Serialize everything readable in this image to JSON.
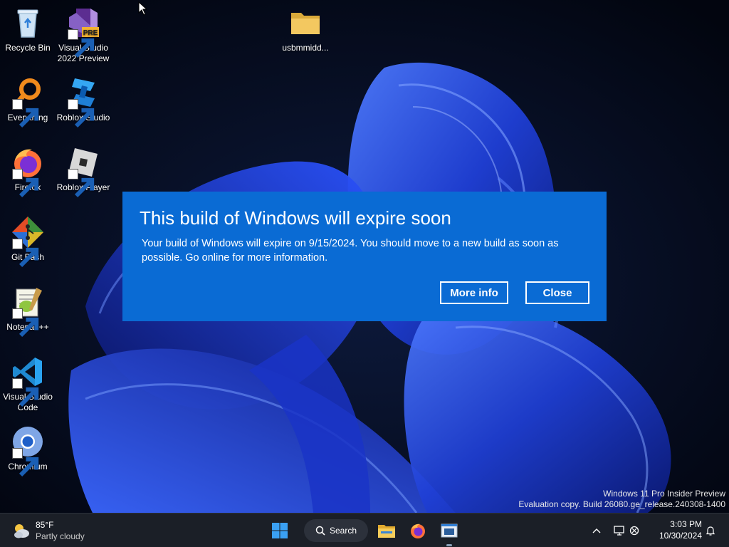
{
  "desktop": {
    "icons": [
      {
        "label": "Recycle Bin",
        "icon": "recycle-bin-icon"
      },
      {
        "label": "Visual Studio 2022 Preview",
        "icon": "visual-studio-icon",
        "badge": "PRE"
      },
      {
        "label": "usbmmidd...",
        "icon": "folder-icon"
      },
      {
        "label": "Everything",
        "icon": "everything-search-icon"
      },
      {
        "label": "Roblox Studio",
        "icon": "roblox-studio-icon"
      },
      {
        "label": "Firefox",
        "icon": "firefox-icon"
      },
      {
        "label": "Roblox Player",
        "icon": "roblox-player-icon"
      },
      {
        "label": "Git Bash",
        "icon": "git-bash-icon"
      },
      {
        "label": "Notepad++",
        "icon": "notepad-plus-plus-icon"
      },
      {
        "label": "Visual Studio Code",
        "icon": "vscode-icon"
      },
      {
        "label": "Chromium",
        "icon": "chromium-icon"
      }
    ]
  },
  "dialog": {
    "title": "This build of Windows will expire soon",
    "body": "Your build of Windows will expire on 9/15/2024. You should move to a new build as soon as possible. Go online for more information.",
    "more_info": "More info",
    "close": "Close",
    "background": "#0a6bd4"
  },
  "watermark": {
    "line1": "Windows 11 Pro Insider Preview",
    "line2": "Evaluation copy. Build 26080.ge_release.240308-1400"
  },
  "taskbar": {
    "weather_temp": "85°F",
    "weather_condition": "Partly cloudy",
    "search_label": "Search",
    "apps": [
      "start-icon",
      "search-icon",
      "file-explorer-icon",
      "firefox-icon",
      "app-window-icon"
    ],
    "tray": [
      "chevron-up-icon",
      "display-icon",
      "network-disconnected-icon",
      "notification-bell-icon"
    ],
    "time": "3:03 PM",
    "date": "10/30/2024"
  }
}
